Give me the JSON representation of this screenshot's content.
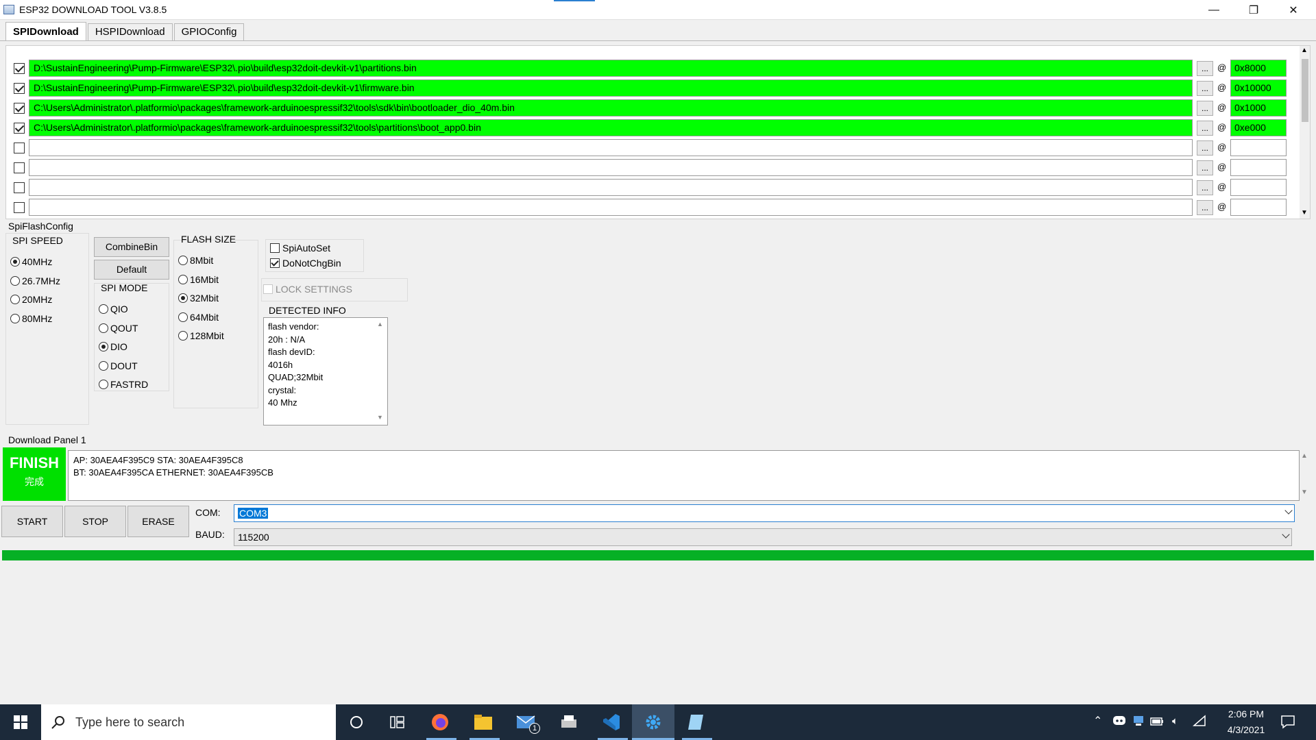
{
  "window": {
    "title": "ESP32 DOWNLOAD TOOL V3.8.5",
    "minimize_glyph": "—",
    "maximize_glyph": "❐",
    "close_glyph": "✕"
  },
  "tabs": [
    {
      "label": "SPIDownload",
      "active": true
    },
    {
      "label": "HSPIDownload",
      "active": false
    },
    {
      "label": "GPIOConfig",
      "active": false
    }
  ],
  "files": [
    {
      "checked": true,
      "path": "D:\\SustainEngineering\\Pump-Firmware\\ESP32\\.pio\\build\\esp32doit-devkit-v1\\partitions.bin",
      "browse": "...",
      "at": "@",
      "address": "0x8000"
    },
    {
      "checked": true,
      "path": "D:\\SustainEngineering\\Pump-Firmware\\ESP32\\.pio\\build\\esp32doit-devkit-v1\\firmware.bin",
      "browse": "...",
      "at": "@",
      "address": "0x10000"
    },
    {
      "checked": true,
      "path": "C:\\Users\\Administrator\\.platformio\\packages\\framework-arduinoespressif32\\tools\\sdk\\bin\\bootloader_dio_40m.bin",
      "browse": "...",
      "at": "@",
      "address": "0x1000"
    },
    {
      "checked": true,
      "path": "C:\\Users\\Administrator\\.platformio\\packages\\framework-arduinoespressif32\\tools\\partitions\\boot_app0.bin",
      "browse": "...",
      "at": "@",
      "address": "0xe000"
    },
    {
      "checked": false,
      "path": "",
      "browse": "...",
      "at": "@",
      "address": ""
    },
    {
      "checked": false,
      "path": "",
      "browse": "...",
      "at": "@",
      "address": ""
    },
    {
      "checked": false,
      "path": "",
      "browse": "...",
      "at": "@",
      "address": ""
    },
    {
      "checked": false,
      "path": "",
      "browse": "...",
      "at": "@",
      "address": ""
    }
  ],
  "spi_config": {
    "title": "SpiFlashConfig",
    "speed": {
      "label": "SPI SPEED",
      "options": [
        "40MHz",
        "26.7MHz",
        "20MHz",
        "80MHz"
      ],
      "selected": "40MHz"
    },
    "combine_bin": "CombineBin",
    "default": "Default",
    "mode": {
      "label": "SPI MODE",
      "options": [
        "QIO",
        "QOUT",
        "DIO",
        "DOUT",
        "FASTRD"
      ],
      "selected": "DIO"
    },
    "flash_size": {
      "label": "FLASH SIZE",
      "options": [
        "8Mbit",
        "16Mbit",
        "32Mbit",
        "64Mbit",
        "128Mbit"
      ],
      "selected": "32Mbit"
    },
    "spi_auto_set": {
      "label": "SpiAutoSet",
      "checked": false
    },
    "do_not_chg_bin": {
      "label": "DoNotChgBin",
      "checked": true
    },
    "lock_settings": {
      "label": "LOCK SETTINGS",
      "checked": false
    },
    "detected": {
      "label": "DETECTED INFO",
      "lines": [
        "flash vendor:",
        "20h : N/A",
        "flash devID:",
        "4016h",
        "QUAD;32Mbit",
        "crystal:",
        "40 Mhz"
      ]
    }
  },
  "download": {
    "title": "Download Panel 1",
    "status": "FINISH",
    "status_sub": "完成",
    "log": [
      "AP:  30AEA4F395C9  STA:  30AEA4F395C8",
      "BT:  30AEA4F395CA  ETHERNET:  30AEA4F395CB"
    ],
    "start": "START",
    "stop": "STOP",
    "erase": "ERASE",
    "com_label": "COM:",
    "com_value": "COM3",
    "baud_label": "BAUD:",
    "baud_value": "115200",
    "progress": 1.0
  },
  "taskbar": {
    "search_placeholder": "Type here to search",
    "time": "2:06 PM",
    "date": "4/3/2021",
    "mail_badge": "1"
  },
  "colors": {
    "loaded_green": "#00ff00",
    "finish_green": "#00e000",
    "progress_green": "#06b025",
    "taskbar": "#1c2a3a"
  }
}
